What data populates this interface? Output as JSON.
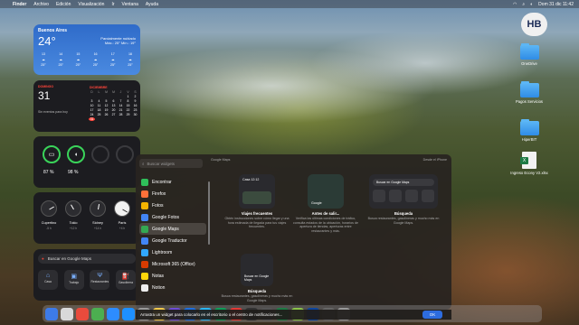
{
  "menubar": {
    "app": "Finder",
    "items": [
      "Archivo",
      "Edición",
      "Visualización",
      "Ir",
      "Ventana",
      "Ayuda"
    ],
    "clock": "Dom 31 dic  11:42"
  },
  "weather": {
    "city": "Buenos Aires",
    "temp": "24°",
    "condition": "Parcialmente nublado",
    "range": "Máx.: 25° Mín.: 19°",
    "hours": [
      {
        "h": "13",
        "t": "25°"
      },
      {
        "h": "14",
        "t": "25°"
      },
      {
        "h": "15",
        "t": "25°"
      },
      {
        "h": "16",
        "t": "25°"
      },
      {
        "h": "17",
        "t": "25°"
      },
      {
        "h": "18",
        "t": "25°"
      }
    ]
  },
  "calendar": {
    "weekday": "DOMINGO",
    "day": "31",
    "no_events": "Sin eventos para hoy",
    "month": "DICIEMBRE",
    "headers": [
      "D",
      "L",
      "M",
      "M",
      "J",
      "V",
      "S"
    ],
    "days": [
      "",
      "",
      "",
      "",
      "",
      "1",
      "2",
      "3",
      "4",
      "5",
      "6",
      "7",
      "8",
      "9",
      "10",
      "11",
      "12",
      "13",
      "14",
      "15",
      "16",
      "17",
      "18",
      "19",
      "20",
      "21",
      "22",
      "23",
      "24",
      "25",
      "26",
      "27",
      "28",
      "29",
      "30",
      "31"
    ]
  },
  "battery": {
    "devices": [
      {
        "name": "laptop",
        "pct": "87 %"
      },
      {
        "name": "mouse",
        "pct": "98 %"
      }
    ]
  },
  "clocks": [
    {
      "city": "Cupertino",
      "sub": "-5 h"
    },
    {
      "city": "Tokio",
      "sub": "+12 h"
    },
    {
      "city": "Sídney",
      "sub": "+14 h"
    },
    {
      "city": "París",
      "sub": "+4 h"
    }
  ],
  "gmaps": {
    "search": "Buscar en Google Maps",
    "buttons": [
      "Casa",
      "Trabajo",
      "Restaurantes",
      "Gasolinera"
    ]
  },
  "desktop": [
    {
      "label": "OneDrive",
      "type": "folder"
    },
    {
      "label": "Pagos Servicios",
      "type": "folder"
    },
    {
      "label": "HiperBIT",
      "type": "folder"
    },
    {
      "label": "Ingreso Econy V2.xlsx",
      "type": "xls"
    }
  ],
  "logo": "HB",
  "gallery": {
    "search_placeholder": "Buscar widgets",
    "header": "Google Maps",
    "header_right": "Desde el iPhone",
    "apps": [
      {
        "name": "Encontrar",
        "color": "#2fbf5a"
      },
      {
        "name": "Firefox",
        "color": "#ff7139"
      },
      {
        "name": "Fotos",
        "color": "#f4b400"
      },
      {
        "name": "Google Fotos",
        "color": "#4285f4"
      },
      {
        "name": "Google Maps",
        "color": "#34a853"
      },
      {
        "name": "Google Traductor",
        "color": "#4285f4"
      },
      {
        "name": "Lightroom",
        "color": "#31a8ff"
      },
      {
        "name": "Microsoft 365 (Office)",
        "color": "#d83b01"
      },
      {
        "name": "Notas",
        "color": "#ffd60a"
      },
      {
        "name": "Notion",
        "color": "#eeeeee"
      }
    ],
    "cards": [
      {
        "title": "Viajes frecuentes",
        "desc": "Obtén instrucciones sobre cómo llegar y una hora estimada de llegada para tus viajes frecuentes.",
        "inner": "Casa 12:12"
      },
      {
        "title": "Antes de salir...",
        "desc": "Verifica las últimas condiciones de tráfico, consulta estados de la ubicación, horarios de apertura de tiendas, aperturas entre restaurantes y más.",
        "inner": "Google"
      },
      {
        "title": "Búsqueda",
        "desc": "Busca restaurantes, gasolineras y mucho más en Google Maps.",
        "inner": "Buscar en Google Maps"
      },
      {
        "title": "Búsqueda",
        "desc": "Busca restaurantes, gasolineras y mucho más en Google Maps.",
        "inner": "Buscar en Google Maps"
      }
    ]
  },
  "bottom_hint": "Arrastra un widget para colocarlo en el escritorio o el centro de notificaciones...",
  "ok": "OK",
  "dock": [
    "#3d7be8",
    "#d9d9d9",
    "#e94b3c",
    "#4caf50",
    "#2d8cff",
    "#1e90ff",
    "#9a9a9a",
    "#f2c94c",
    "#6e4cd8",
    "#1d6fe0",
    "#29b6f6",
    "#0f9d58",
    "#e53935",
    "#333333",
    "#555555",
    "#1e7b45",
    "#8bc34a",
    "#0d47a1",
    "#666666",
    "#999999"
  ]
}
